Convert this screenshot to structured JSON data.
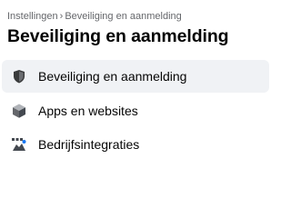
{
  "breadcrumb": {
    "parent": "Instellingen",
    "separator": "›",
    "current": "Beveiliging en aanmelding"
  },
  "page_title": "Beveiliging en aanmelding",
  "menu": {
    "items": [
      {
        "label": "Beveiliging en aanmelding",
        "icon": "shield-icon",
        "active": true
      },
      {
        "label": "Apps en websites",
        "icon": "cube-icon",
        "active": false
      },
      {
        "label": "Bedrijfsintegraties",
        "icon": "business-integrations-icon",
        "active": false
      }
    ]
  },
  "colors": {
    "text_primary": "#050505",
    "text_secondary": "#65676b",
    "active_item_background": "#f0f2f5"
  }
}
